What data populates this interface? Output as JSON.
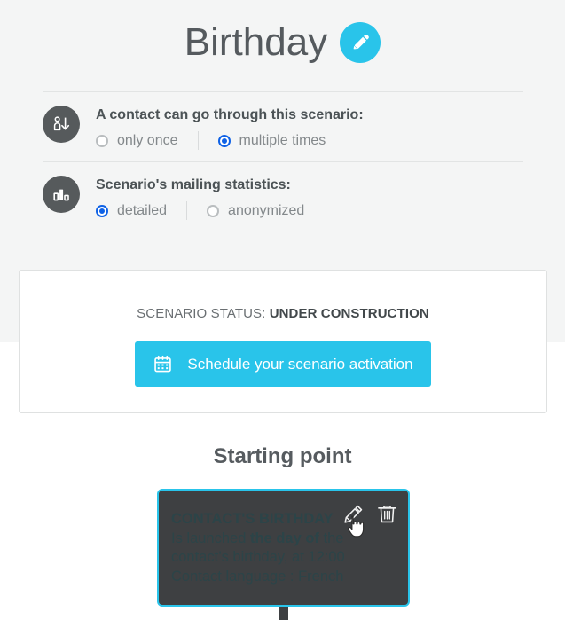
{
  "header": {
    "title": "Birthday",
    "edit_icon": "pencil-icon",
    "accent_color": "#29c4ea"
  },
  "settings": {
    "rows": [
      {
        "icon": "contact-flow-icon",
        "label": "A contact can go through this scenario:",
        "options": [
          {
            "label": "only once",
            "selected": false
          },
          {
            "label": "multiple times",
            "selected": true
          }
        ]
      },
      {
        "icon": "bar-chart-icon",
        "label": "Scenario's mailing statistics:",
        "options": [
          {
            "label": "detailed",
            "selected": true
          },
          {
            "label": "anonymized",
            "selected": false
          }
        ]
      }
    ]
  },
  "status_card": {
    "status_label": "SCENARIO STATUS:",
    "status_value": "UNDER CONSTRUCTION",
    "schedule_button_label": "Schedule your scenario activation",
    "schedule_button_icon": "calendar-icon",
    "button_color": "#29c4ea"
  },
  "starting_point": {
    "title": "Starting point",
    "node": {
      "heading": "CONTACT'S BIRTHDAY",
      "line_1_pre": "Is launched ",
      "line_1_bold": "the day of",
      "line_1_post": " the contact’s birthday, at 12:00",
      "line_2": "Contact language : French",
      "border_color": "#29c4ea",
      "background_color": "#3e4042",
      "actions": [
        {
          "name": "edit-node",
          "icon": "pencil-icon"
        },
        {
          "name": "delete-node",
          "icon": "trash-icon"
        }
      ]
    }
  },
  "colors": {
    "page_background_top": "#f4f5f5",
    "page_background_bottom": "#ffffff",
    "radio_selected": "#0f62e6",
    "icon_circle": "#565a5c"
  }
}
